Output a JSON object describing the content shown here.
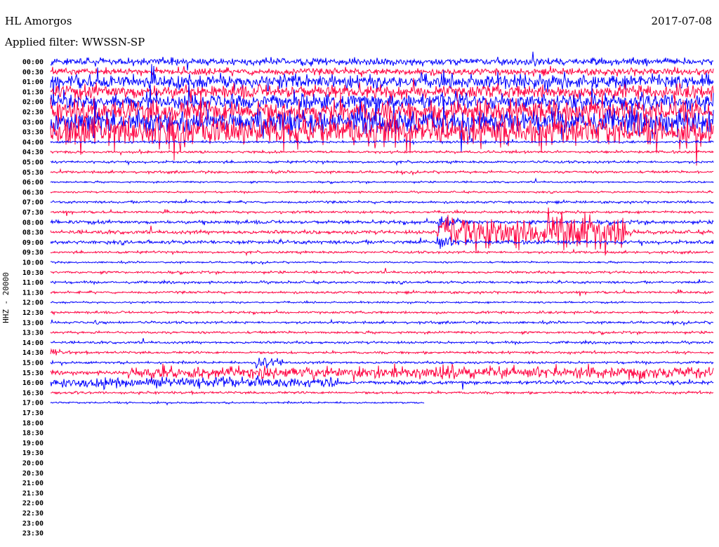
{
  "header": {
    "station": "HL Amorgos",
    "date": "2017-07-08",
    "filter": "Applied filter: WWSSN-SP"
  },
  "chart_data": {
    "type": "line",
    "title": "HL Amorgos 2017-07-08",
    "ylabel": "HHZ - 20000",
    "row_minutes": 30,
    "colors": [
      "#0000ff",
      "#ff0040"
    ],
    "rows": [
      "00:00",
      "00:30",
      "01:00",
      "01:30",
      "02:00",
      "02:30",
      "03:00",
      "03:30",
      "04:00",
      "04:30",
      "05:00",
      "05:30",
      "06:00",
      "06:30",
      "07:00",
      "07:30",
      "08:00",
      "08:30",
      "09:00",
      "09:30",
      "10:00",
      "10:30",
      "11:00",
      "11:30",
      "12:00",
      "12:30",
      "13:00",
      "13:30",
      "14:00",
      "14:30",
      "15:00",
      "15:30",
      "16:00",
      "16:30",
      "17:00",
      "17:30",
      "18:00",
      "18:30",
      "19:00",
      "19:30",
      "20:00",
      "20:30",
      "21:00",
      "21:30",
      "22:00",
      "22:30",
      "23:00",
      "23:30"
    ],
    "noise_level": [
      6,
      6,
      12,
      12,
      14,
      20,
      20,
      25,
      2,
      2,
      2,
      2,
      1.5,
      1.5,
      2,
      2,
      3,
      3,
      3,
      2,
      1.5,
      2,
      2,
      2,
      1.5,
      2,
      2,
      2,
      2,
      2,
      2,
      3,
      3,
      2,
      1.5
    ],
    "data_end_minute_last_row": 16.9,
    "events": [
      {
        "row": "03:00",
        "start_min": 0,
        "end_min": 22,
        "amp": 20
      },
      {
        "row": "03:30",
        "start_min": 0,
        "end_min": 18.5,
        "amp": 26
      },
      {
        "row": "08:00",
        "start_min": 17.5,
        "end_min": 19,
        "amp": 30
      },
      {
        "row": "08:30",
        "start_min": 17.5,
        "end_min": 26,
        "amp": 40
      },
      {
        "row": "08:30",
        "start_min": 26,
        "end_min": 27.5,
        "amp": 12
      },
      {
        "row": "09:00",
        "start_min": 17.5,
        "end_min": 19,
        "amp": 25
      },
      {
        "row": "13:00",
        "start_min": 2,
        "end_min": 3.5,
        "amp": 9
      },
      {
        "row": "14:30",
        "start_min": 0,
        "end_min": 1.5,
        "amp": 10
      },
      {
        "row": "15:00",
        "start_min": 9.3,
        "end_min": 10.5,
        "amp": 25
      },
      {
        "row": "15:30",
        "start_min": 3.5,
        "end_min": 30,
        "amp": 15
      },
      {
        "row": "16:00",
        "start_min": 0,
        "end_min": 13,
        "amp": 12
      }
    ]
  }
}
